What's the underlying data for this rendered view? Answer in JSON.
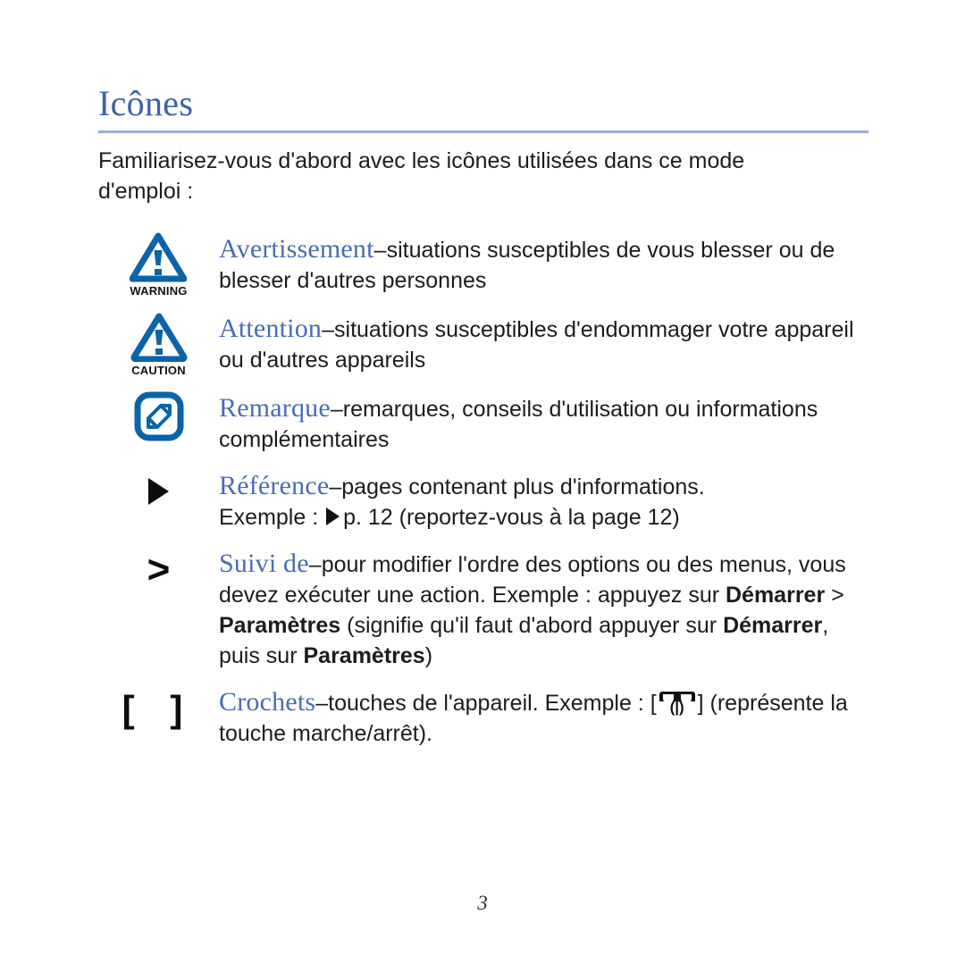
{
  "document": {
    "title": "Icônes",
    "title_color": "#3e62a8",
    "rule_color": "#9aadd2",
    "intro": "Familiarisez-vous d'abord avec les icônes utilisées dans ce mode d'emploi :",
    "page_number": "3"
  },
  "icons": {
    "warning": {
      "label": "WARNING",
      "color": "#0b63a8",
      "name": "warning-triangle-icon"
    },
    "caution": {
      "label": "CAUTION",
      "color": "#0b63a8",
      "name": "caution-triangle-icon"
    },
    "note": {
      "color": "#0b63a8",
      "name": "note-pencil-icon"
    },
    "reference": {
      "glyph": "▶",
      "color": "#0d0d0d",
      "name": "reference-arrow-icon"
    },
    "followed_by": {
      "glyph": ">",
      "color": "#0d0d0d",
      "name": "chevron-right-icon"
    },
    "brackets": {
      "glyph": "[ ]",
      "color": "#0d0d0d",
      "name": "square-brackets-icon"
    },
    "power_key": {
      "name": "power-key-icon",
      "symbol": "〈|〉"
    }
  },
  "entries": [
    {
      "key": "avertissement",
      "term": "Avertissement",
      "dash": "–",
      "body": "situations susceptibles de vous blesser ou de blesser d'autres personnes",
      "icon_label": "WARNING"
    },
    {
      "key": "attention",
      "term": "Attention",
      "dash": "–",
      "body": "situations susceptibles d'endommager votre appareil ou d'autres appareils",
      "icon_label": "CAUTION"
    },
    {
      "key": "remarque",
      "term": "Remarque",
      "dash": "–",
      "body": "remarques, conseils d'utilisation ou informations complémentaires"
    },
    {
      "key": "reference",
      "term": "Référence",
      "dash": "–",
      "body": "pages contenant plus d'informations.",
      "example_prefix": "Exemple : ",
      "example_suffix": "p. 12 (reportez-vous à la page 12)"
    },
    {
      "key": "suivi_de",
      "term": "Suivi de",
      "dash": "–",
      "body": "pour modifier l'ordre des options ou des menus, vous devez exécuter une action. Exemple : appuyez sur ",
      "bold_1": "Démarrer",
      "mid_1": " > ",
      "bold_2": "Paramètres",
      "mid_2": " (signifie qu'il faut d'abord appuyer sur ",
      "bold_3": "Démarrer",
      "mid_3": ", puis sur ",
      "bold_4": "Paramètres",
      "tail": ")"
    },
    {
      "key": "crochets",
      "term": "Crochets",
      "dash": "–",
      "body": "touches de l'appareil. Exemple : [",
      "tail": "] (représente la touche marche/arrêt)."
    }
  ]
}
